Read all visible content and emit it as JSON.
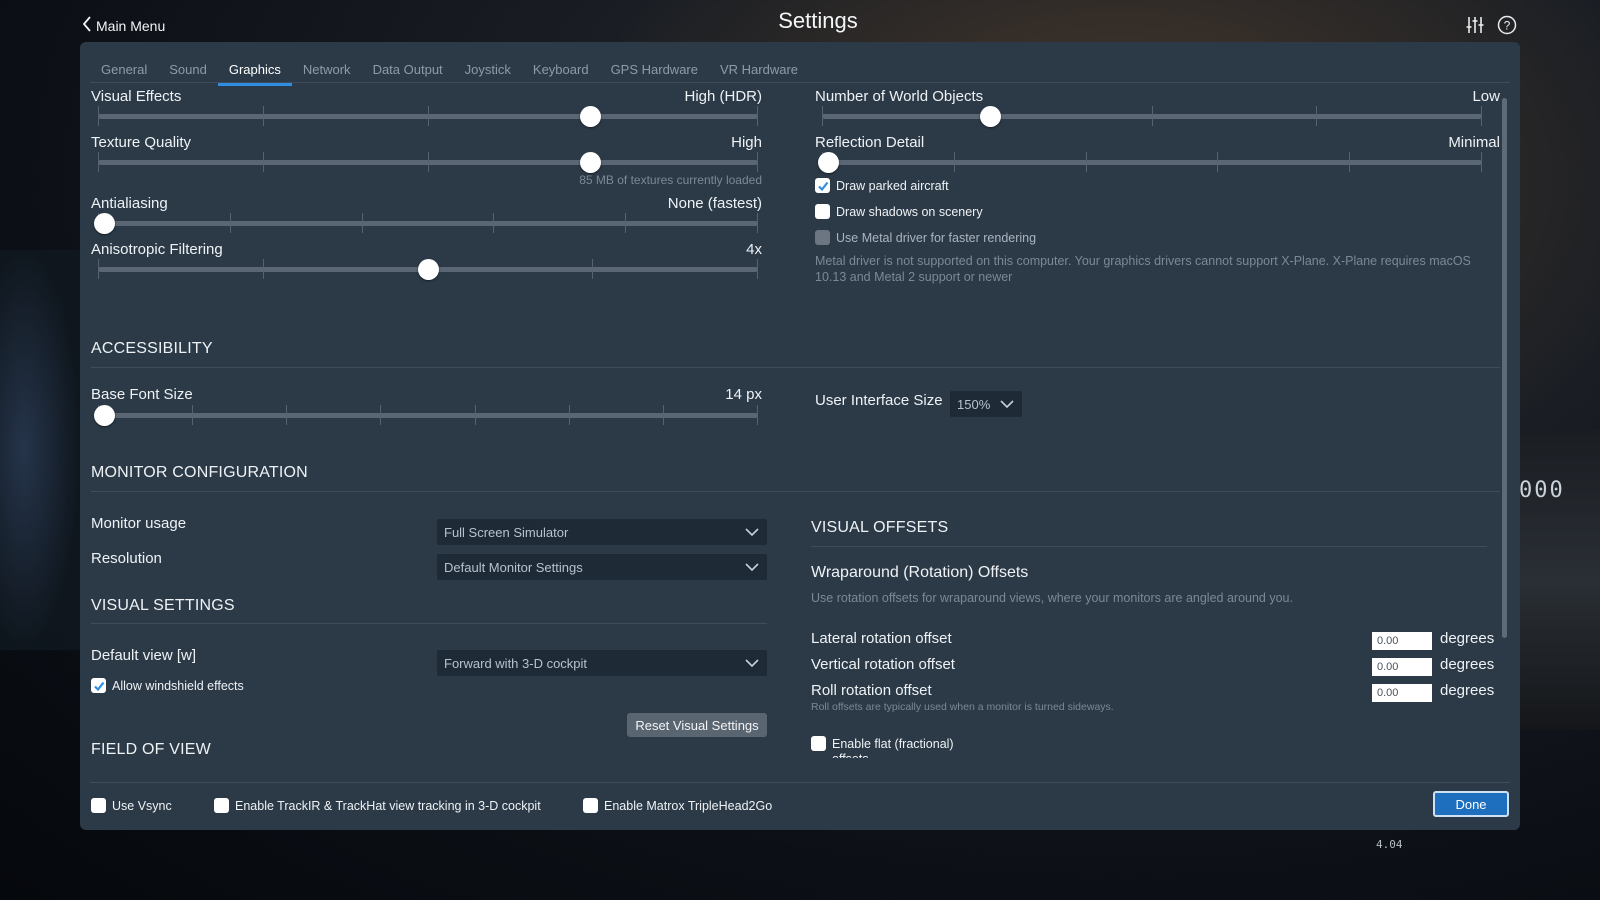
{
  "header": {
    "back_label": "Main Menu",
    "title": "Settings"
  },
  "tabs": [
    {
      "label": "General",
      "active": false
    },
    {
      "label": "Sound",
      "active": false
    },
    {
      "label": "Graphics",
      "active": true
    },
    {
      "label": "Network",
      "active": false
    },
    {
      "label": "Data Output",
      "active": false
    },
    {
      "label": "Joystick",
      "active": false
    },
    {
      "label": "Keyboard",
      "active": false
    },
    {
      "label": "GPS Hardware",
      "active": false
    },
    {
      "label": "VR Hardware",
      "active": false
    }
  ],
  "graphics": {
    "visual_effects": {
      "label": "Visual Effects",
      "value": "High (HDR)",
      "level": 0.75
    },
    "texture_quality": {
      "label": "Texture Quality",
      "value": "High",
      "level": 0.75,
      "note": "85 MB of textures currently loaded"
    },
    "antialiasing": {
      "label": "Antialiasing",
      "value": "None (fastest)",
      "level": 0.0
    },
    "anisotropic": {
      "label": "Anisotropic Filtering",
      "value": "4x",
      "level": 0.5
    },
    "world_objects": {
      "label": "Number of World Objects",
      "value": "Low",
      "level": 0.25
    },
    "reflection": {
      "label": "Reflection Detail",
      "value": "Minimal",
      "level": 0.0
    },
    "draw_parked": {
      "label": "Draw parked aircraft",
      "checked": true
    },
    "draw_shadows": {
      "label": "Draw shadows on scenery",
      "checked": false
    },
    "metal_driver": {
      "label": "Use Metal driver for faster rendering",
      "checked": false,
      "disabled": true
    },
    "metal_note_1": "Metal driver is not supported on this computer. Your graphics drivers cannot support X-Plane. X-Plane requires macOS",
    "metal_note_2": "10.13 and Metal 2 support or newer"
  },
  "accessibility": {
    "title": "ACCESSIBILITY",
    "base_font": {
      "label": "Base Font Size",
      "value": "14 px",
      "level": 0.0
    },
    "ui_size": {
      "label": "User Interface Size",
      "value": "150%"
    }
  },
  "monitor": {
    "title": "MONITOR CONFIGURATION",
    "usage": {
      "label": "Monitor usage",
      "value": "Full Screen Simulator"
    },
    "resolution": {
      "label": "Resolution",
      "value": "Default Monitor Settings"
    }
  },
  "visual_settings": {
    "title": "VISUAL SETTINGS",
    "default_view": {
      "label": "Default view [w]",
      "value": "Forward with 3-D cockpit"
    },
    "windshield": {
      "label": "Allow windshield effects",
      "checked": true
    },
    "reset_label": "Reset Visual Settings"
  },
  "field_of_view": {
    "title": "FIELD OF VIEW"
  },
  "visual_offsets": {
    "title": "VISUAL OFFSETS",
    "subtitle": "Wraparound (Rotation) Offsets",
    "description": "Use rotation offsets for wraparound views, where your monitors are angled around you.",
    "lateral": {
      "label": "Lateral rotation offset",
      "value": "0.00",
      "unit": "degrees"
    },
    "vertical": {
      "label": "Vertical rotation offset",
      "value": "0.00",
      "unit": "degrees"
    },
    "roll": {
      "label": "Roll rotation offset",
      "value": "0.00",
      "unit": "degrees"
    },
    "roll_note": "Roll offsets are typically used when a monitor is turned sideways.",
    "flat": {
      "label": "Enable flat (fractional)",
      "label_cont": "offsets",
      "checked": false
    }
  },
  "bottom": {
    "vsync": {
      "label": "Use Vsync",
      "checked": false
    },
    "trackir": {
      "label": "Enable TrackIR & TrackHat view tracking in 3-D cockpit",
      "checked": false
    },
    "matrox": {
      "label": "Enable Matrox TripleHead2Go",
      "checked": false
    },
    "done_label": "Done"
  },
  "background": {
    "readout": "000",
    "panel_label": "4.04"
  },
  "colors": {
    "panel_bg": "#2c3a48",
    "accent_blue": "#2f8ee0",
    "done_button": "#1f6fbf"
  }
}
